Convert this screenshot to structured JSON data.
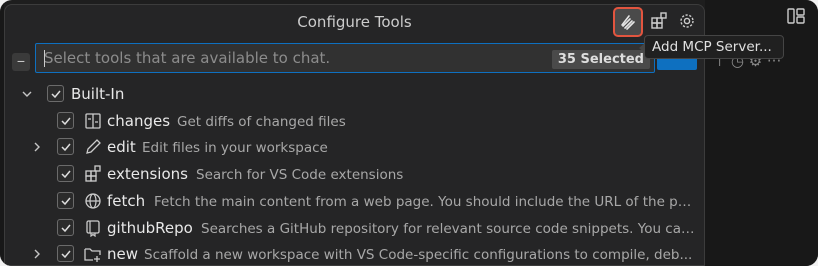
{
  "panel": {
    "title": "Configure Tools",
    "search_placeholder": "Select tools that are available to chat.",
    "selected_badge": "35 Selected",
    "tooltip": "Add MCP Server..."
  },
  "tree": {
    "group_label": "Built-In",
    "items": [
      {
        "name": "changes",
        "description": "Get diffs of changed files",
        "icon": "diff-icon",
        "expandable": false
      },
      {
        "name": "edit",
        "description": "Edit files in your workspace",
        "icon": "pencil-icon",
        "expandable": true
      },
      {
        "name": "extensions",
        "description": "Search for VS Code extensions",
        "icon": "extensions-icon",
        "expandable": false
      },
      {
        "name": "fetch",
        "description": "Fetch the main content from a web page. You should include the URL of the pa...",
        "icon": "globe-icon",
        "expandable": false
      },
      {
        "name": "githubRepo",
        "description": "Searches a GitHub repository for relevant source code snippets. You can...",
        "icon": "repo-icon",
        "expandable": false
      },
      {
        "name": "new",
        "description": "Scaffold a new workspace with VS Code-specific configurations to compile, deb...",
        "icon": "new-folder-icon",
        "expandable": true
      }
    ]
  },
  "colors": {
    "accent": "#0e70c0",
    "highlight": "#e2553f"
  }
}
